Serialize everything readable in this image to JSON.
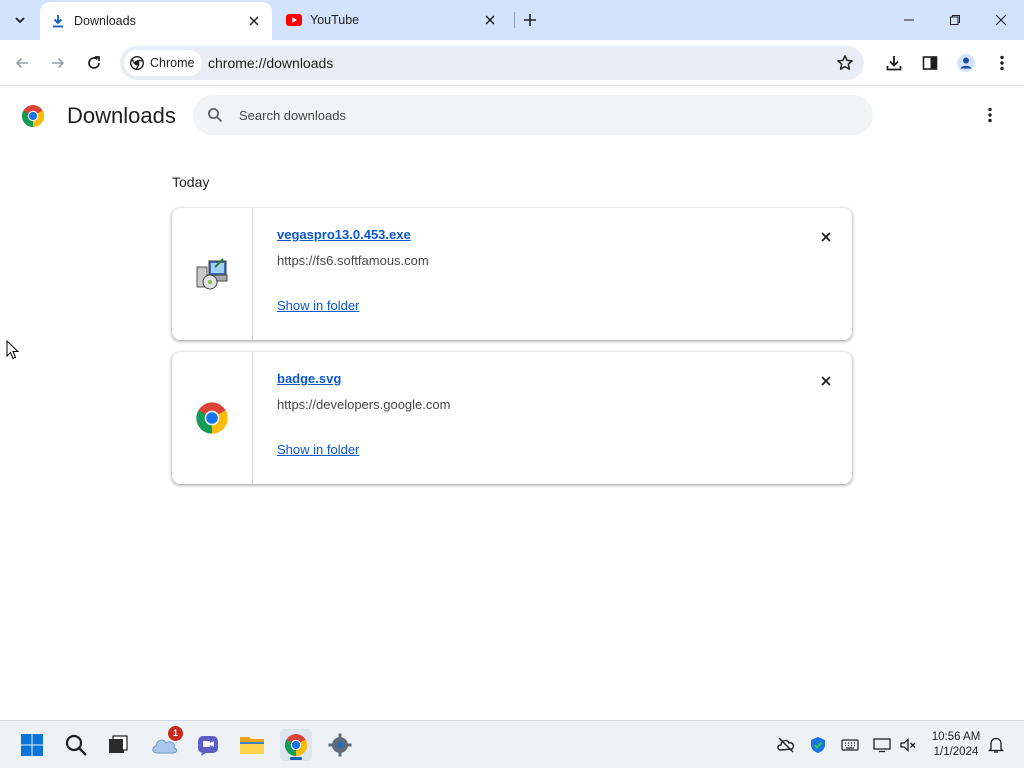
{
  "tabs": [
    {
      "title": "Downloads",
      "active": true,
      "icon": "download-icon"
    },
    {
      "title": "YouTube",
      "active": false,
      "icon": "youtube-icon"
    }
  ],
  "omnibox": {
    "chip_label": "Chrome",
    "url": "chrome://downloads"
  },
  "page": {
    "title": "Downloads",
    "search_placeholder": "Search downloads",
    "section_date": "Today"
  },
  "downloads": [
    {
      "file_name": "vegaspro13.0.453.exe",
      "source_url": "https://fs6.softfamous.com",
      "action": "Show in folder",
      "icon": "installer-icon"
    },
    {
      "file_name": "badge.svg",
      "source_url": "https://developers.google.com",
      "action": "Show in folder",
      "icon": "chrome-icon"
    }
  ],
  "taskbar": {
    "apps": [
      "start",
      "search",
      "task-view",
      "onedrive",
      "teams",
      "file-explorer",
      "chrome",
      "settings"
    ],
    "onedrive_badge": "1",
    "clock_time": "10:56 AM",
    "clock_date": "1/1/2024"
  },
  "colors": {
    "accent": "#0b57d0",
    "tabstrip": "#d3e3fd",
    "omnibox": "#e9eef6"
  }
}
